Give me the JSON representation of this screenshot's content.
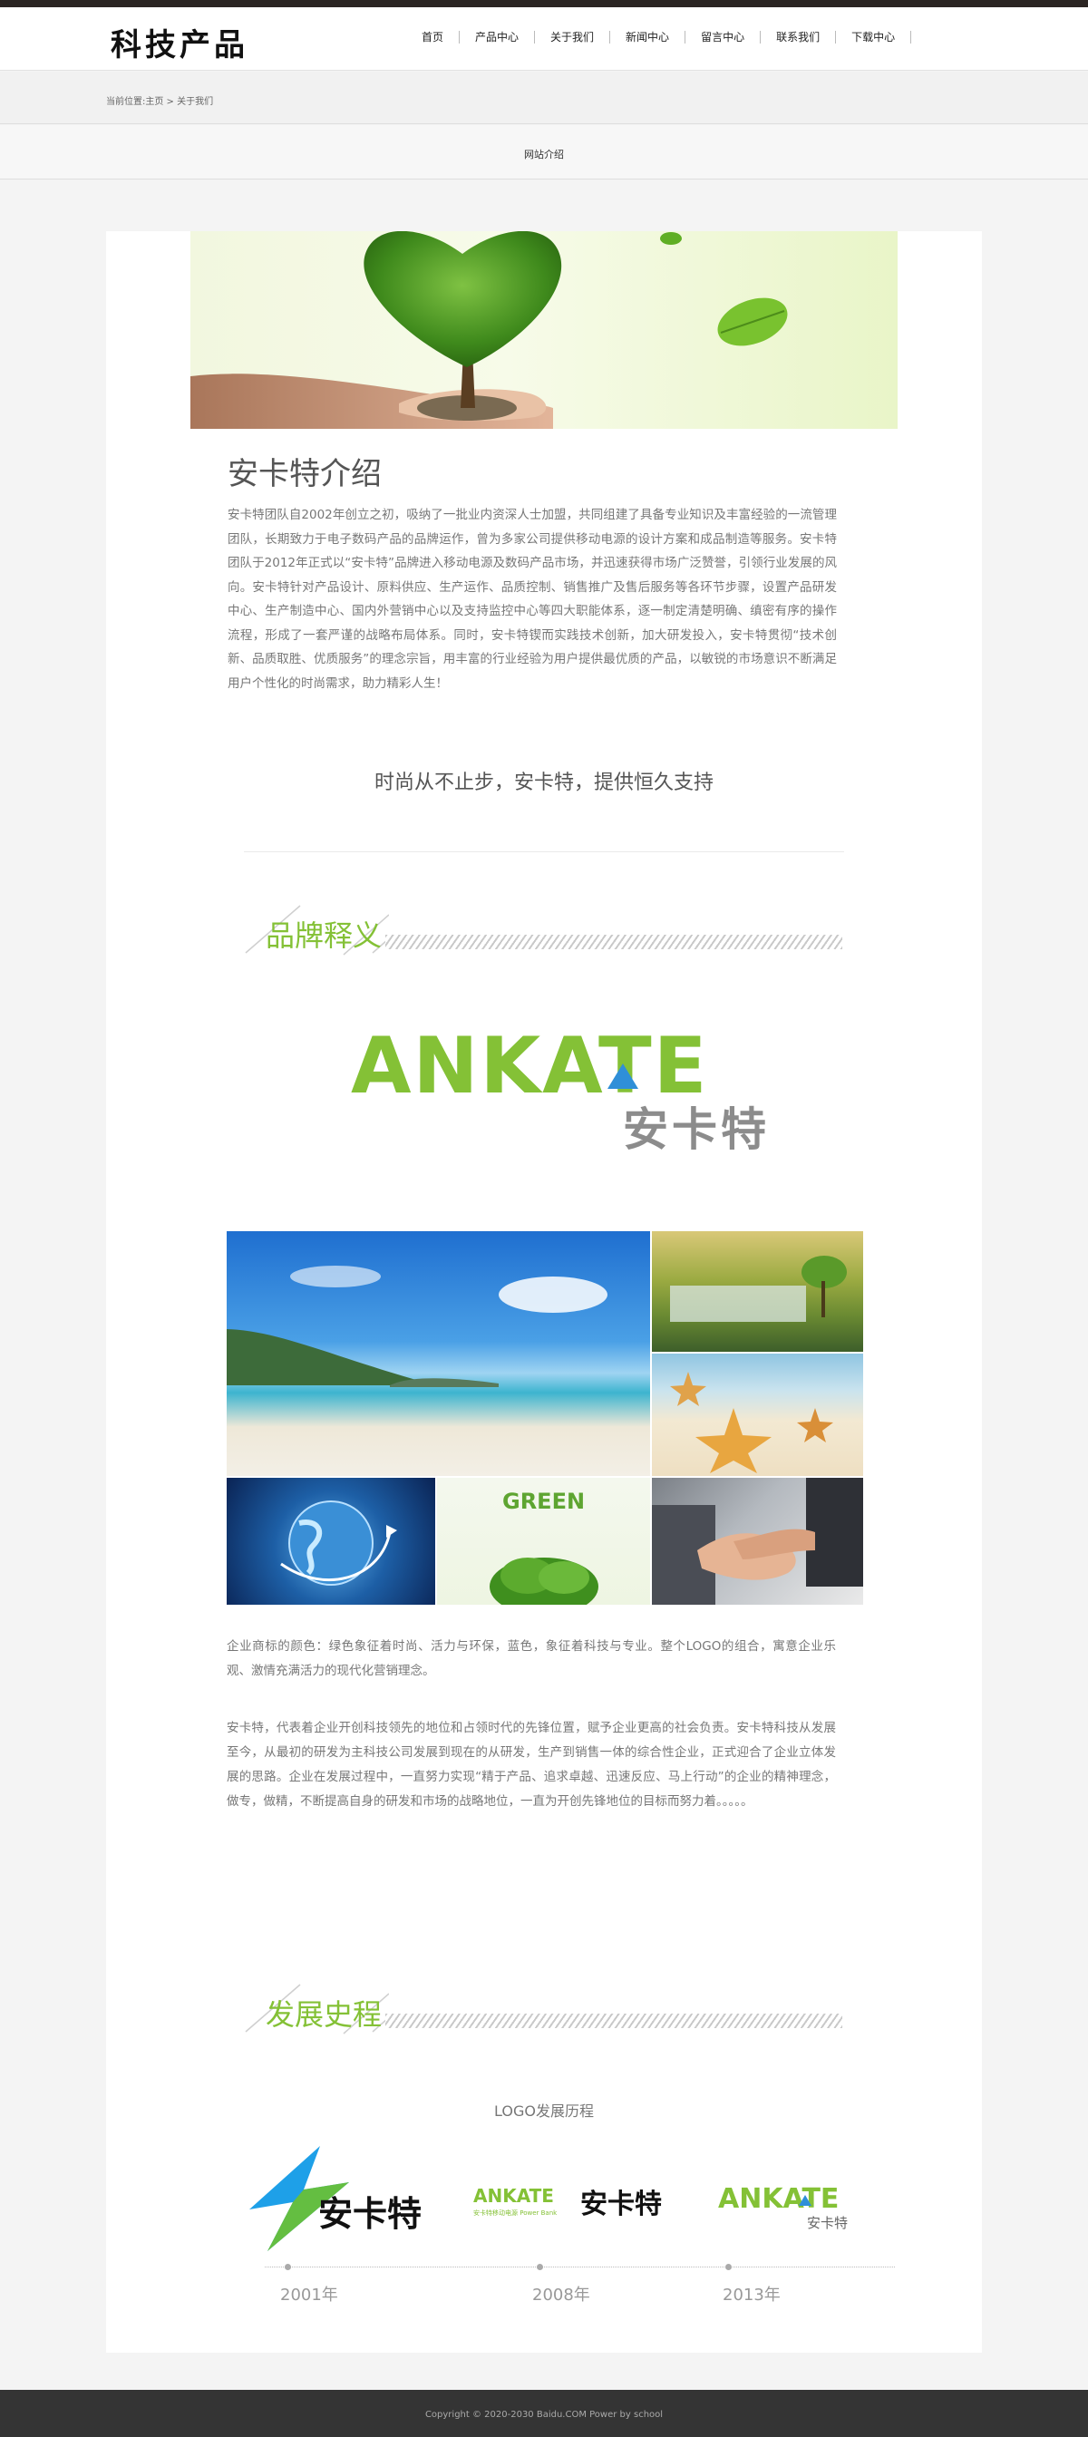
{
  "site": {
    "logo_text": "科技产品"
  },
  "nav": {
    "items": [
      "首页",
      "产品中心",
      "关于我们",
      "新闻中心",
      "留言中心",
      "联系我们",
      "下载中心"
    ]
  },
  "breadcrumb": {
    "prefix": "当前位置:",
    "home": "主页",
    "separator": " > ",
    "current": "关于我们"
  },
  "subnav": {
    "item": "网站介绍"
  },
  "intro": {
    "title": "安卡特介绍",
    "text": "安卡特团队自2002年创立之初，吸纳了一批业内资深人士加盟，共同组建了具备专业知识及丰富经验的一流管理团队，长期致力于电子数码产品的品牌运作，曾为多家公司提供移动电源的设计方案和成品制造等服务。安卡特团队于2012年正式以“安卡特”品牌进入移动电源及数码产品市场，并迅速获得市场广泛赞誉，引领行业发展的风向。安卡特针对产品设计、原料供应、生产运作、品质控制、销售推广及售后服务等各环节步骤，设置产品研发中心、生产制造中心、国内外营销中心以及支持监控中心等四大职能体系，逐一制定清楚明确、缜密有序的操作流程，形成了一套严谨的战略布局体系。同时，安卡特锲而实践技术创新，加大研发投入，安卡特贯彻“技术创新、品质取胜、优质服务”的理念宗旨，用丰富的行业经验为用户提供最优质的产品，以敏锐的市场意识不断满足用户个性化的时尚需求，助力精彩人生！",
    "slogan": "时尚从不止步，安卡特，提供恒久支持"
  },
  "brand": {
    "section_title": "品牌释义",
    "logo_en": "ANKATE",
    "logo_cn": "安卡特",
    "gallery_green_text": "GREEN",
    "color_text": "企业商标的颜色：绿色象征着时尚、活力与环保，蓝色，象征着科技与专业。整个LOGO的组合，寓意企业乐观、激情充满活力的现代化营销理念。",
    "meaning_text": "安卡特，代表着企业开创科技领先的地位和占领时代的先锋位置，赋予企业更高的社会负责。安卡特科技从发展至今，从最初的研发为主科技公司发展到现在的从研发，生产到销售一体的综合性企业，正式迎合了企业立体发展的思路。企业在发展过程中，一直努力实现“精于产品、追求卓越、迅速反应、马上行动”的企业的精神理念，做专，做精，不断提高自身的研发和市场的战略地位，一直为开创先锋地位的目标而努力着。。。。。",
    "accent_green": "#84c136",
    "accent_blue": "#2f8fd8"
  },
  "history": {
    "section_title": "发展史程",
    "label": "LOGO发展历程",
    "logo2_en": "ANKATE",
    "logo2_cn": "安卡特",
    "logo2_small": "安卡特移动电源 Power Bank",
    "items": [
      {
        "year": "2001年",
        "logo_cn": "安卡特"
      },
      {
        "year": "2008年",
        "logo_cn": "安卡特"
      },
      {
        "year": "2013年",
        "logo_cn": "安卡特",
        "logo_en": "ANKATE"
      }
    ]
  },
  "footer": {
    "text": "Copyright © 2020-2030 Baidu.COM Power by school"
  }
}
